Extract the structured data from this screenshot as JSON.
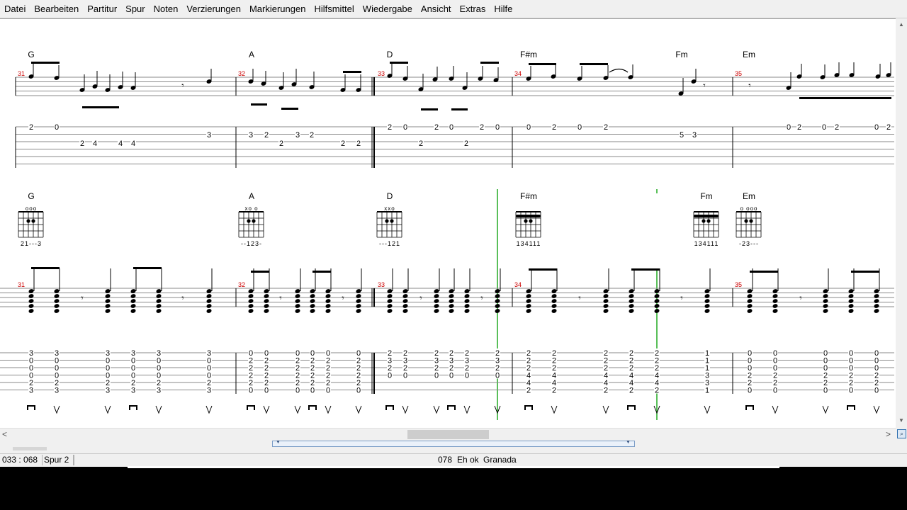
{
  "menu": [
    "Datei",
    "Bearbeiten",
    "Partitur",
    "Spur",
    "Noten",
    "Verzierungen",
    "Markierungen",
    "Hilfsmittel",
    "Wiedergabe",
    "Ansicht",
    "Extras",
    "Hilfe"
  ],
  "system1": {
    "chords": [
      "G",
      "A",
      "D",
      "F#m",
      "Fm",
      "Em"
    ],
    "measure_numbers": [
      "31",
      "32",
      "33",
      "34",
      "35"
    ],
    "tab": [
      {
        "string": 1,
        "frets": [
          "2",
          "0",
          "3",
          "3",
          "2",
          "2",
          "0",
          "2",
          "0",
          "2",
          "0",
          "0",
          "2",
          "0",
          "2",
          "0",
          "2",
          "0",
          "2",
          "0",
          "2"
        ]
      },
      {
        "string": 2,
        "frets": [
          "2",
          "2",
          "2",
          "5",
          "3"
        ]
      },
      {
        "string": 3,
        "frets": [
          "2",
          "4",
          "4",
          "4",
          "2",
          "2"
        ]
      }
    ]
  },
  "system2": {
    "chords": [
      {
        "name": "G",
        "markers": "ooo",
        "fingering": "21---3"
      },
      {
        "name": "A",
        "markers": "xo  o",
        "fingering": "--123-"
      },
      {
        "name": "D",
        "markers": "xxo",
        "fingering": "---121"
      },
      {
        "name": "F#m",
        "markers": "",
        "fingering": "134111"
      },
      {
        "name": "Fm",
        "markers": "",
        "fingering": "134111"
      },
      {
        "name": "Em",
        "markers": "o  ooo",
        "fingering": "-23---"
      }
    ],
    "measure_numbers": [
      "31",
      "32",
      "33",
      "34",
      "35"
    ],
    "chord_columns": [
      {
        "frets": [
          "3",
          "0",
          "0",
          "0",
          "2",
          "3"
        ]
      },
      {
        "frets": [
          "0",
          "2",
          "2",
          "2",
          "2",
          "0"
        ]
      },
      {
        "frets": [
          "2",
          "3",
          "2",
          "0"
        ]
      },
      {
        "frets": [
          "2",
          "2",
          "2",
          "4",
          "4",
          "2"
        ]
      },
      {
        "frets": [
          "1",
          "1",
          "1",
          "3",
          "3",
          "1"
        ]
      },
      {
        "frets": [
          "0",
          "0",
          "0",
          "2",
          "2",
          "0"
        ]
      }
    ]
  },
  "status": {
    "position": "033 : 068",
    "track": "Spur 2",
    "bar": "078",
    "tempo_label": "Eh ok",
    "song": "Granada"
  },
  "icons": {
    "zoom": "zoom-icon",
    "scroll_left": "arrow-left-icon",
    "scroll_right": "arrow-right-icon"
  },
  "colors": {
    "measure_number": "#cc0000",
    "cursor": "#22aa22",
    "menubar": "#f0f0f0",
    "page": "#ffffff"
  }
}
